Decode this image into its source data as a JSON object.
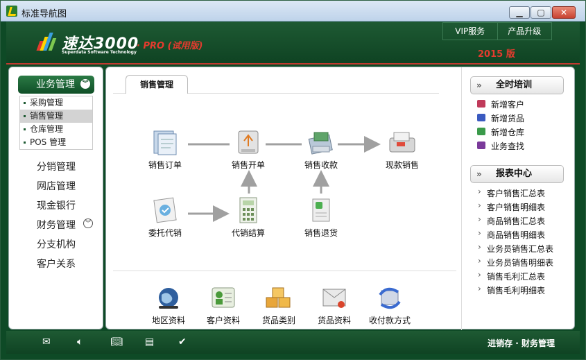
{
  "window": {
    "title": "标准导航图"
  },
  "header": {
    "brand": "速达3000",
    "brand_sub": "Superdata Software Technology",
    "brand_pro": "· PRO (试用版)",
    "tabs": [
      "VIP服务",
      "产品升级"
    ],
    "year": "2015 版"
  },
  "sidebar": {
    "active": "业务管理",
    "sub_items": [
      "采购管理",
      "销售管理",
      "仓库管理",
      "POS 管理"
    ],
    "selected_index": 1,
    "items": [
      "分销管理",
      "网店管理",
      "现金银行",
      "财务管理",
      "分支机构",
      "客户关系"
    ]
  },
  "main": {
    "tab": "销售管理",
    "flow": {
      "order": "销售订单",
      "billing": "销售开单",
      "collect": "销售收款",
      "cash": "现款销售",
      "consign": "委托代销",
      "settle": "代销结算",
      "return": "销售退货"
    },
    "basics": [
      "地区资料",
      "客户资料",
      "货品类别",
      "货品资料",
      "收付款方式"
    ]
  },
  "right": {
    "train_title": "全时培训",
    "train_links": [
      "新增客户",
      "新增货品",
      "新增仓库",
      "业务查找"
    ],
    "report_title": "报表中心",
    "reports": [
      "客户销售汇总表",
      "客户销售明细表",
      "商品销售汇总表",
      "商品销售明细表",
      "业务员销售汇总表",
      "业务员销售明细表",
      "销售毛利汇总表",
      "销售毛利明细表"
    ]
  },
  "footer": {
    "text": "进销存 · 财务管理"
  },
  "colors": {
    "brand_green": "#1e5a33",
    "accent_red": "#e33b2e"
  }
}
